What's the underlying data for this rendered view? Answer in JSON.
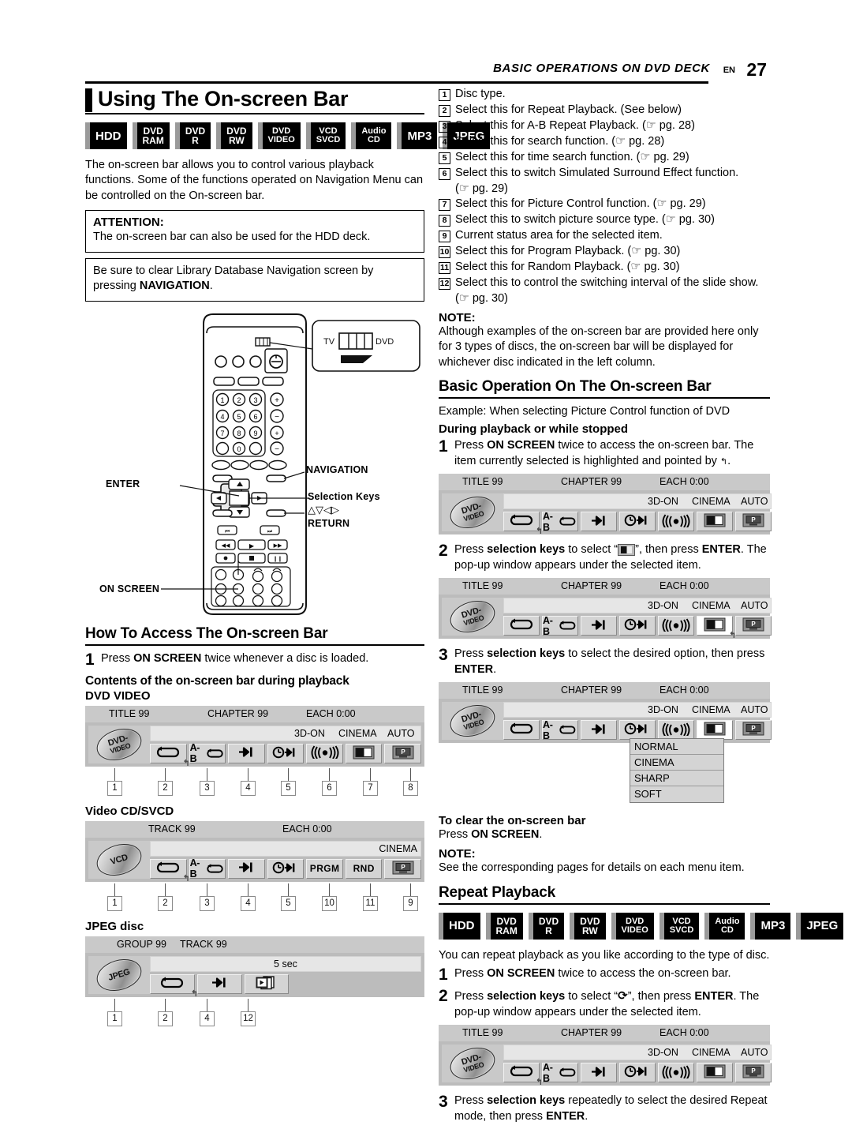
{
  "header": {
    "title": "BASIC OPERATIONS ON DVD DECK",
    "en": "EN",
    "page": "27"
  },
  "left": {
    "title": "Using The On-screen Bar",
    "badges": [
      {
        "l1": "HDD",
        "l2": "",
        "size": "one"
      },
      {
        "l1": "DVD",
        "l2": "RAM",
        "size": "two"
      },
      {
        "l1": "DVD",
        "l2": "R",
        "size": "two"
      },
      {
        "l1": "DVD",
        "l2": "RW",
        "size": "two"
      },
      {
        "l1": "DVD",
        "l2": "VIDEO",
        "size": "small"
      },
      {
        "l1": "VCD",
        "l2": "SVCD",
        "size": "small"
      },
      {
        "l1": "Audio",
        "l2": "CD",
        "size": "small"
      },
      {
        "l1": "MP3",
        "l2": "",
        "size": "one"
      },
      {
        "l1": "JPEG",
        "l2": "",
        "size": "one"
      }
    ],
    "intro": "The on-screen bar allows you to control various playback functions. Some of the functions operated on Navigation Menu can be controlled on the On-screen bar.",
    "attention_title": "ATTENTION:",
    "attention_text": "The on-screen bar can also be used for the HDD deck.",
    "navigation_note_a": "Be sure to clear Library Database Navigation screen by pressing ",
    "navigation_note_b": "NAVIGATION",
    "navigation_note_c": ".",
    "remote": {
      "tv_label": "TV",
      "dvd_label": "DVD",
      "navigation": "NAVIGATION",
      "enter": "ENTER",
      "selection_keys": "Selection Keys",
      "selection_arrows": "△▽◁▷",
      "return": "RETURN",
      "on_screen": "ON SCREEN",
      "keys": [
        "1",
        "2",
        "3",
        "4",
        "5",
        "6",
        "7",
        "8",
        "9",
        "0"
      ]
    },
    "howto_title": "How To Access The On-screen Bar",
    "howto_step1_n": "1",
    "howto_step1_a": "Press ",
    "howto_step1_b": "ON SCREEN",
    "howto_step1_c": " twice whenever a disc is loaded.",
    "contents_title": "Contents of the on-screen bar during playback",
    "dvd_video_label": "DVD VIDEO",
    "video_cd_label": "Video CD/SVCD",
    "jpeg_label": "JPEG disc"
  },
  "right": {
    "numbered": [
      {
        "n": "1",
        "text": "Disc type.",
        "sub": ""
      },
      {
        "n": "2",
        "text": "Select this for Repeat Playback. (See below)",
        "sub": ""
      },
      {
        "n": "3",
        "text": "Select this for A-B Repeat Playback. (☞ pg. 28)",
        "sub": ""
      },
      {
        "n": "4",
        "text": "Select this for search function. (☞ pg. 28)",
        "sub": ""
      },
      {
        "n": "5",
        "text": "Select this for time search function. (☞ pg. 29)",
        "sub": ""
      },
      {
        "n": "6",
        "text": "Select this to switch Simulated Surround Effect function.",
        "sub": "(☞ pg. 29)"
      },
      {
        "n": "7",
        "text": "Select this for Picture Control function. (☞ pg. 29)",
        "sub": ""
      },
      {
        "n": "8",
        "text": "Select this to switch picture source type. (☞ pg. 30)",
        "sub": ""
      },
      {
        "n": "9",
        "text": "Current status area for the selected item.",
        "sub": ""
      },
      {
        "n": "10",
        "text": "Select this for Program Playback. (☞ pg. 30)",
        "sub": ""
      },
      {
        "n": "11",
        "text": "Select this for Random Playback. (☞ pg. 30)",
        "sub": ""
      },
      {
        "n": "12",
        "text": "Select this to control the switching interval of the slide show.",
        "sub": "(☞ pg. 30)"
      }
    ],
    "note1_title": "NOTE:",
    "note1_text": "Although examples of the on-screen bar are provided here only for 3 types of discs, the on-screen bar will be displayed for whichever disc indicated in the left column.",
    "basic_title": "Basic Operation On The On-screen Bar",
    "example": "Example: When selecting Picture Control function of DVD",
    "during": "During playback or while stopped",
    "s1_n": "1",
    "s1_a": "Press ",
    "s1_b": "ON SCREEN",
    "s1_c": " twice to access the on-screen bar. The item currently selected is highlighted and pointed by ",
    "s1_d": "↰",
    "s1_e": ".",
    "s2_n": "2",
    "s2_a": "Press ",
    "s2_b": "selection keys",
    "s2_c": " to select “",
    "s2_icon": "picture-control-icon",
    "s2_d": "”, then press ",
    "s2_e": "ENTER",
    "s2_f": ". The pop-up window appears under the selected item.",
    "s3_n": "3",
    "s3_a": "Press ",
    "s3_b": "selection keys",
    "s3_c": " to select the desired option, then press ",
    "s3_d": "ENTER",
    "s3_e": ".",
    "popup_options": [
      "NORMAL",
      "CINEMA",
      "SHARP",
      "SOFT"
    ],
    "clear_title": "To clear the on-screen bar",
    "clear_a": "Press ",
    "clear_b": "ON SCREEN",
    "clear_c": ".",
    "note2_title": "NOTE:",
    "note2_text": "See the corresponding pages for details on each menu item.",
    "repeat_title": "Repeat Playback",
    "repeat_intro": "You can repeat playback as you like according to the type of disc.",
    "r1_n": "1",
    "r1_a": "Press ",
    "r1_b": "ON SCREEN",
    "r1_c": " twice to access the on-screen bar.",
    "r2_n": "2",
    "r2_a": "Press ",
    "r2_b": "selection keys",
    "r2_c": " to select “",
    "r2_icon": "repeat-icon",
    "r2_d": "”, then press ",
    "r2_e": "ENTER",
    "r2_f": ". The pop-up window appears under the selected item.",
    "r3_n": "3",
    "r3_a": "Press ",
    "r3_b": "selection keys",
    "r3_c": " repeatedly to select the desired Repeat mode, then press ",
    "r3_d": "ENTER",
    "r3_e": "."
  },
  "osb": {
    "dvd": {
      "disc_l1": "DVD-",
      "disc_l2": "VIDEO",
      "top": [
        "TITLE 99",
        "CHAPTER 99",
        "EACH 0:00"
      ],
      "status": [
        "3D-ON",
        "CINEMA",
        "AUTO"
      ],
      "cells": [
        "repeat",
        "ab-repeat",
        "search",
        "time-search",
        "surround",
        "picture-control",
        "source-type"
      ],
      "callouts": [
        "1",
        "2",
        "3",
        "4",
        "5",
        "6",
        "7",
        "8"
      ]
    },
    "vcd": {
      "disc_l1": "VCD",
      "disc_l2": "",
      "top": [
        "TRACK 99",
        "EACH 0:00"
      ],
      "status": [
        "CINEMA"
      ],
      "cells": [
        "repeat",
        "ab-repeat",
        "search",
        "time-search",
        "PRGM",
        "RND",
        "source-type"
      ],
      "callouts": [
        "1",
        "2",
        "3",
        "4",
        "5",
        "10",
        "11",
        "9"
      ]
    },
    "jpeg": {
      "disc_l1": "JPEG",
      "disc_l2": "",
      "top": [
        "GROUP 99",
        "TRACK 99"
      ],
      "status": [
        "5 sec"
      ],
      "cells": [
        "repeat",
        "search",
        "slideshow"
      ],
      "callouts": [
        "1",
        "2",
        "4",
        "12"
      ]
    }
  },
  "colors": {
    "bar_bg": "#bcbcbc",
    "bar_top": "#c9c9c9",
    "cell": "#d4d4d4",
    "status": "#e6e6e6",
    "badge": "#000000",
    "badge_tab": "#9a9a9a"
  }
}
